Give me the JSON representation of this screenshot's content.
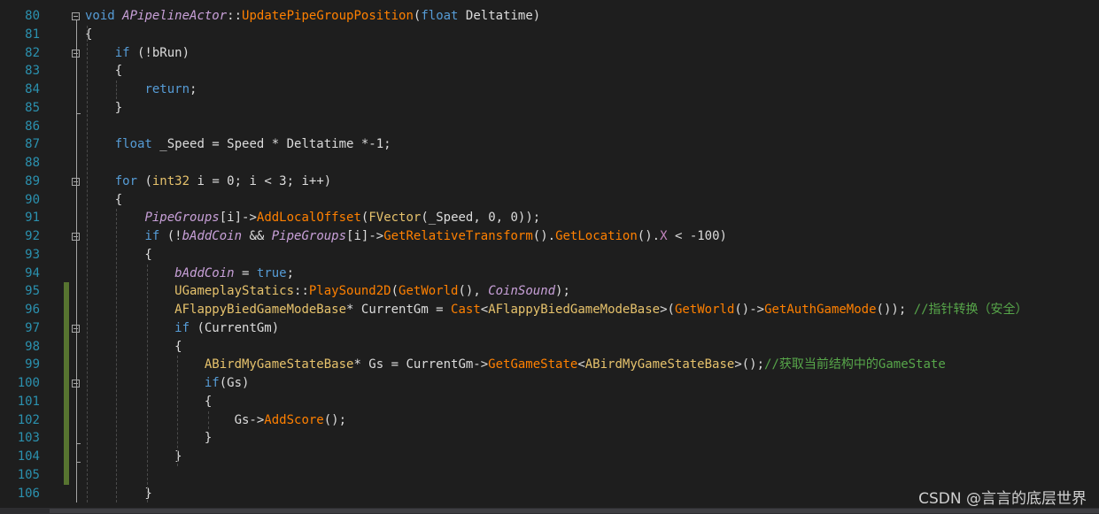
{
  "editor": {
    "lines": [
      {
        "n": "80",
        "segs": [
          [
            "kw",
            "void "
          ],
          [
            "ital",
            "APipelineActor"
          ],
          [
            "pl",
            "::"
          ],
          [
            "fn",
            "UpdatePipeGroupPosition"
          ],
          [
            "pl",
            "("
          ],
          [
            "kw",
            "float "
          ],
          [
            "pl",
            "Deltatime)"
          ]
        ]
      },
      {
        "n": "81",
        "segs": [
          [
            "pl",
            "{"
          ]
        ]
      },
      {
        "n": "82",
        "segs": [
          [
            "pl",
            "    "
          ],
          [
            "kw",
            "if"
          ],
          [
            "pl",
            " (!bRun)"
          ]
        ]
      },
      {
        "n": "83",
        "segs": [
          [
            "pl",
            "    {"
          ]
        ]
      },
      {
        "n": "84",
        "segs": [
          [
            "pl",
            "        "
          ],
          [
            "kw",
            "return"
          ],
          [
            "pl",
            ";"
          ]
        ]
      },
      {
        "n": "85",
        "segs": [
          [
            "pl",
            "    }"
          ]
        ]
      },
      {
        "n": "86",
        "segs": []
      },
      {
        "n": "87",
        "segs": [
          [
            "pl",
            "    "
          ],
          [
            "kw",
            "float"
          ],
          [
            "pl",
            " _Speed = Speed * Deltatime *-1;"
          ]
        ]
      },
      {
        "n": "88",
        "segs": []
      },
      {
        "n": "89",
        "segs": [
          [
            "pl",
            "    "
          ],
          [
            "kw",
            "for"
          ],
          [
            "pl",
            " ("
          ],
          [
            "cls",
            "int32"
          ],
          [
            "pl",
            " i = 0; i < 3; i++)"
          ]
        ]
      },
      {
        "n": "90",
        "segs": [
          [
            "pl",
            "    {"
          ]
        ]
      },
      {
        "n": "91",
        "segs": [
          [
            "pl",
            "        "
          ],
          [
            "ital",
            "PipeGroups"
          ],
          [
            "pl",
            "[i]->"
          ],
          [
            "fn",
            "AddLocalOffset"
          ],
          [
            "pl",
            "("
          ],
          [
            "cls",
            "FVector"
          ],
          [
            "pl",
            "(_Speed, 0, 0));"
          ]
        ]
      },
      {
        "n": "92",
        "segs": [
          [
            "pl",
            "        "
          ],
          [
            "kw",
            "if"
          ],
          [
            "pl",
            " (!"
          ],
          [
            "ital",
            "bAddCoin"
          ],
          [
            "pl",
            " && "
          ],
          [
            "ital",
            "PipeGroups"
          ],
          [
            "pl",
            "[i]->"
          ],
          [
            "fn",
            "GetRelativeTransform"
          ],
          [
            "pl",
            "()."
          ],
          [
            "fn",
            "GetLocation"
          ],
          [
            "pl",
            "()."
          ],
          [
            "macro",
            "X"
          ],
          [
            "pl",
            " < -100)"
          ]
        ]
      },
      {
        "n": "93",
        "segs": [
          [
            "pl",
            "        {"
          ]
        ]
      },
      {
        "n": "94",
        "segs": [
          [
            "pl",
            "            "
          ],
          [
            "ital",
            "bAddCoin"
          ],
          [
            "pl",
            " = "
          ],
          [
            "kw",
            "true"
          ],
          [
            "pl",
            ";"
          ]
        ]
      },
      {
        "n": "95",
        "segs": [
          [
            "pl",
            "            "
          ],
          [
            "cls",
            "UGameplayStatics"
          ],
          [
            "pl",
            "::"
          ],
          [
            "fn",
            "PlaySound2D"
          ],
          [
            "pl",
            "("
          ],
          [
            "fn",
            "GetWorld"
          ],
          [
            "pl",
            "(), "
          ],
          [
            "ital",
            "CoinSound"
          ],
          [
            "pl",
            ");"
          ]
        ]
      },
      {
        "n": "96",
        "segs": [
          [
            "pl",
            "            "
          ],
          [
            "cls",
            "AFlappyBiedGameModeBase"
          ],
          [
            "pl",
            "* CurrentGm = "
          ],
          [
            "fn",
            "Cast"
          ],
          [
            "pl",
            "<"
          ],
          [
            "cls",
            "AFlappyBiedGameModeBase"
          ],
          [
            "pl",
            ">("
          ],
          [
            "fn",
            "GetWorld"
          ],
          [
            "pl",
            "()->"
          ],
          [
            "fn",
            "GetAuthGameMode"
          ],
          [
            "pl",
            "()); "
          ],
          [
            "cm",
            "//指针转换（安全）"
          ]
        ]
      },
      {
        "n": "97",
        "segs": [
          [
            "pl",
            "            "
          ],
          [
            "kw",
            "if"
          ],
          [
            "pl",
            " (CurrentGm)"
          ]
        ]
      },
      {
        "n": "98",
        "segs": [
          [
            "pl",
            "            {"
          ]
        ]
      },
      {
        "n": "99",
        "segs": [
          [
            "pl",
            "                "
          ],
          [
            "cls",
            "ABirdMyGameStateBase"
          ],
          [
            "pl",
            "* Gs = CurrentGm->"
          ],
          [
            "fn",
            "GetGameState"
          ],
          [
            "pl",
            "<"
          ],
          [
            "cls",
            "ABirdMyGameStateBase"
          ],
          [
            "pl",
            ">();"
          ],
          [
            "cm",
            "//获取当前结构中的GameState"
          ]
        ]
      },
      {
        "n": "100",
        "segs": [
          [
            "pl",
            "                "
          ],
          [
            "kw",
            "if"
          ],
          [
            "pl",
            "(Gs)"
          ]
        ]
      },
      {
        "n": "101",
        "segs": [
          [
            "pl",
            "                {"
          ]
        ]
      },
      {
        "n": "102",
        "segs": [
          [
            "pl",
            "                    Gs->"
          ],
          [
            "fn",
            "AddScore"
          ],
          [
            "pl",
            "();"
          ]
        ]
      },
      {
        "n": "103",
        "segs": [
          [
            "pl",
            "                }"
          ]
        ]
      },
      {
        "n": "104",
        "segs": [
          [
            "pl",
            "            }"
          ]
        ]
      },
      {
        "n": "105",
        "segs": []
      },
      {
        "n": "106",
        "segs": [
          [
            "pl",
            "        }"
          ]
        ]
      }
    ]
  },
  "colors": {
    "background": "#1e1e1e",
    "line_number": "#2b91af",
    "keyword": "#569cd6",
    "class_type": "#e6c26c",
    "function": "#ff8000",
    "comment": "#57a64a",
    "change_bar": "#577430"
  },
  "watermark": "CSDN @言言的底层世界"
}
